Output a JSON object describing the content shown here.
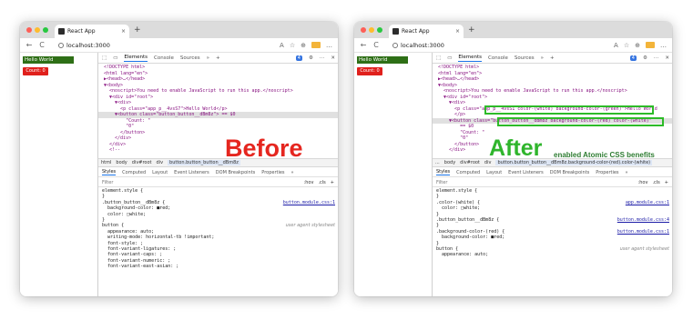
{
  "browser": {
    "tab_title": "React App",
    "tab_close": "×",
    "new_tab": "+",
    "url": "localhost:3000",
    "back": "←",
    "reload": "C",
    "ext_label": "AA"
  },
  "page": {
    "hello_text": "Hello World",
    "count_text": "Count: 0"
  },
  "devtools": {
    "tabs": [
      "Elements",
      "Console",
      "Sources",
      "»",
      "+"
    ],
    "badge": "4"
  },
  "before": {
    "dom_lines": [
      "<!DOCTYPE html>",
      "<html lang=\"en\">",
      "▶<head>…</head>",
      "▼<body>",
      "  <noscript>You need to enable JavaScript to run this app.</noscript>",
      "  ▼<div id=\"root\">",
      "    ▼<div>",
      "      <p class=\"app_p__4vsS7\">Hello World</p>",
      "    ▼<button class=\"button_button__dBm8z\"> == $0",
      "        \"Count: \"",
      "        \"0\"",
      "      </button>",
      "    </div>",
      "  </div>",
      "  <!--"
    ],
    "breadcrumb": [
      "html",
      "body",
      "div#root",
      "div",
      "button.button_button__dBm8z"
    ],
    "style_tabs": [
      "Styles",
      "Computed",
      "Layout",
      "Event Listeners",
      "DOM Breakpoints",
      "Properties",
      "»"
    ],
    "filter": "Filter",
    "filter_right": [
      ":hov",
      ".cls",
      "+"
    ],
    "rules": [
      {
        "text": "element.style {",
        "src": ""
      },
      {
        "text": "}",
        "src": ""
      },
      {
        "text": ".button_button__dBm8z {",
        "src": "button.module.css:1"
      },
      {
        "text": "  background-color: ■red;",
        "src": ""
      },
      {
        "text": "  color: □white;",
        "src": ""
      },
      {
        "text": "}",
        "src": ""
      },
      {
        "text": "button {",
        "src": "user agent stylesheet"
      },
      {
        "text": "  appearance: auto;",
        "src": ""
      },
      {
        "text": "  writing-mode: horizontal-tb !important;",
        "src": ""
      },
      {
        "text": "  font-style: ;",
        "src": ""
      },
      {
        "text": "  font-variant-ligatures: ;",
        "src": ""
      },
      {
        "text": "  font-variant-caps: ;",
        "src": ""
      },
      {
        "text": "  font-variant-numeric: ;",
        "src": ""
      },
      {
        "text": "  font-variant-east-asian: ;",
        "src": ""
      }
    ],
    "label": "Before"
  },
  "after": {
    "dom_lines": [
      "<!DOCTYPE html>",
      "<html lang=\"en\">",
      "▶<head>…</head>",
      "▼<body>",
      "  <noscript>You need to enable JavaScript to run this app.</noscript>",
      "  ▼<div id=\"root\">",
      "    ▼<div>",
      "      <p class=\"app_p__4vsS1 color-(white) background-color-(green)\">Hello World",
      "      </p>",
      "    ▼<button class=\"button_button__dBm8z background-color-(red) color-(white)\"",
      "        == $0",
      "        \"Count: \"",
      "        \"0\"",
      "      </button>",
      "    </div>"
    ],
    "breadcrumb": [
      "...",
      "body",
      "div#root",
      "div",
      "button.button_button__dBm8z.background-color-(red).color-(white)"
    ],
    "style_tabs": [
      "Styles",
      "Computed",
      "Layout",
      "Event Listeners",
      "DOM Breakpoints",
      "Properties",
      "»"
    ],
    "filter": "Filter",
    "filter_right": [
      ":hov",
      ".cls",
      "+"
    ],
    "rules": [
      {
        "text": "element.style {",
        "src": ""
      },
      {
        "text": "}",
        "src": ""
      },
      {
        "text": ".color-(white) {",
        "src": "app.module.css:1"
      },
      {
        "text": "  color: □white;",
        "src": ""
      },
      {
        "text": "}",
        "src": ""
      },
      {
        "text": ".button_button__dBm8z {",
        "src": "button.module.css:4"
      },
      {
        "text": "}",
        "src": ""
      },
      {
        "text": ".background-color-(red) {",
        "src": "button.module.css:1"
      },
      {
        "text": "  background-color: ■red;",
        "src": ""
      },
      {
        "text": "}",
        "src": ""
      },
      {
        "text": "button {",
        "src": "user agent stylesheet"
      },
      {
        "text": "  appearance: auto;",
        "src": ""
      }
    ],
    "label": "After",
    "benefit": "enabled Atomic CSS benefits"
  },
  "colors": {
    "before_label": "#e5261f",
    "after_label": "#2fb52c",
    "highlight": "#2dbb28",
    "hello_bg": "#2e6f16",
    "count_bg": "#e0201c"
  }
}
